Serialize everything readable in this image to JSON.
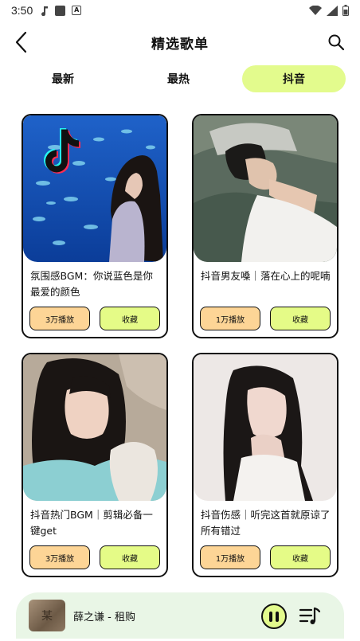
{
  "status": {
    "time": "3:50"
  },
  "header": {
    "title": "精选歌单"
  },
  "tabs": [
    {
      "label": "最新",
      "active": false
    },
    {
      "label": "最热",
      "active": false
    },
    {
      "label": "抖音",
      "active": true
    }
  ],
  "cards": [
    {
      "title": "氛围感BGM：你说蓝色是你最爱的颜色",
      "plays": "3万播放",
      "fav": "收藏"
    },
    {
      "title": "抖音男友嗓｜落在心上的呢喃",
      "plays": "1万播放",
      "fav": "收藏"
    },
    {
      "title": "抖音热门BGM｜剪辑必备一键get",
      "plays": "3万播放",
      "fav": "收藏"
    },
    {
      "title": "抖音伤感｜听完这首就原谅了所有错过",
      "plays": "1万播放",
      "fav": "收藏"
    }
  ],
  "player": {
    "song": "薛之谦 - 租购",
    "album_char": "某"
  },
  "colors": {
    "accent": "#e3fb8d",
    "plays_button": "#fdd596",
    "fav_button": "#e5fb87",
    "player_bg": "#e9f6e6"
  }
}
